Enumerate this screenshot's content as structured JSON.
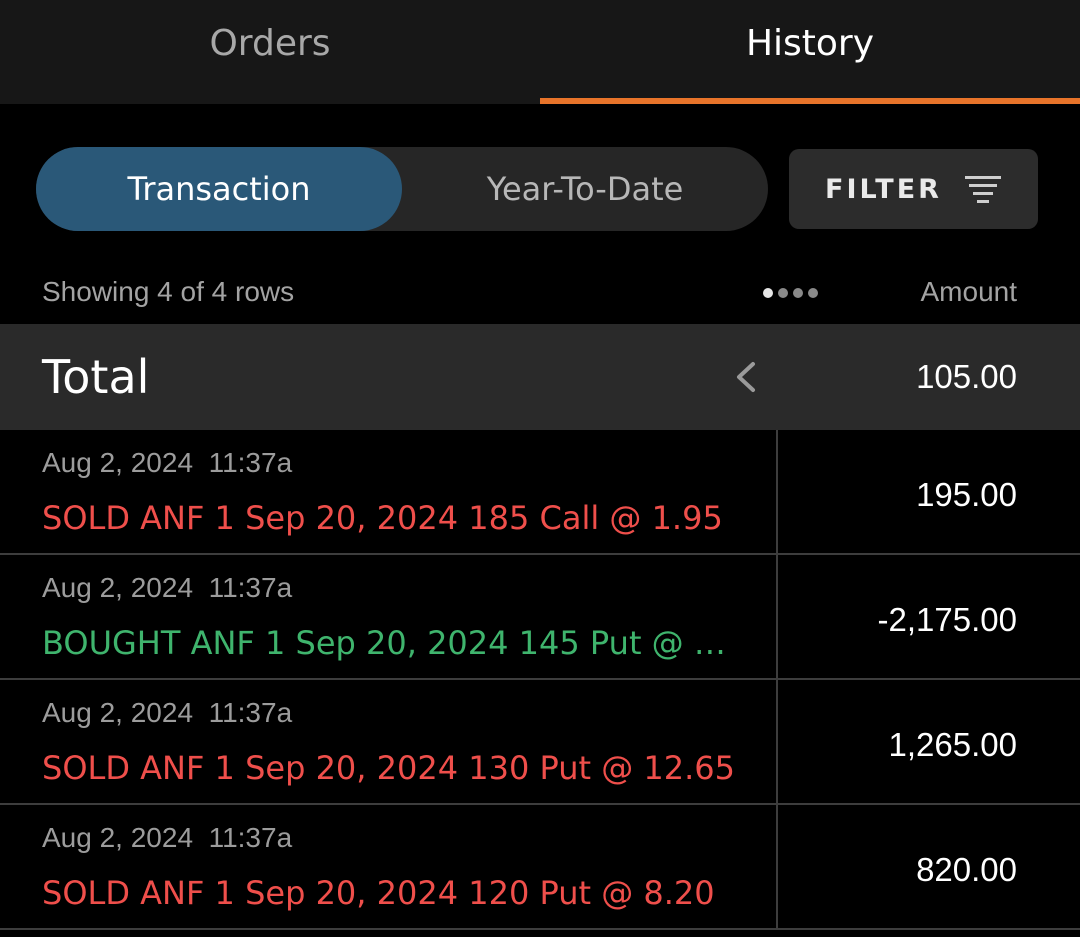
{
  "tabs": {
    "orders": "Orders",
    "history": "History",
    "active": "History"
  },
  "segment": {
    "transaction": "Transaction",
    "year_to_date": "Year-To-Date",
    "selected": "Transaction"
  },
  "filter": {
    "label": "FILTER",
    "icon": "filter-lines-icon"
  },
  "table": {
    "rows_info": "Showing 4 of 4 rows",
    "amount_header": "Amount",
    "pager": {
      "pages": 4,
      "active_page": 1
    },
    "total_label": "Total",
    "total_value": "105.00",
    "rows": [
      {
        "date": "Aug 2, 2024  11:37a",
        "description": "SOLD ANF 1 Sep 20, 2024 185 Call @ 1.95",
        "type": "sold",
        "amount": "195.00"
      },
      {
        "date": "Aug 2, 2024  11:37a",
        "description": "BOUGHT ANF 1 Sep 20, 2024 145 Put @ 2...",
        "type": "bought",
        "amount": "-2,175.00"
      },
      {
        "date": "Aug 2, 2024  11:37a",
        "description": "SOLD ANF 1 Sep 20, 2024 130 Put @ 12.65",
        "type": "sold",
        "amount": "1,265.00"
      },
      {
        "date": "Aug 2, 2024  11:37a",
        "description": "SOLD ANF 1 Sep 20, 2024 120 Put @ 8.20",
        "type": "sold",
        "amount": "820.00"
      }
    ]
  },
  "colors": {
    "accent": "#e8742a",
    "segment_active": "#2a5878",
    "sold": "#ef4f4b",
    "bought": "#3fb46d"
  }
}
